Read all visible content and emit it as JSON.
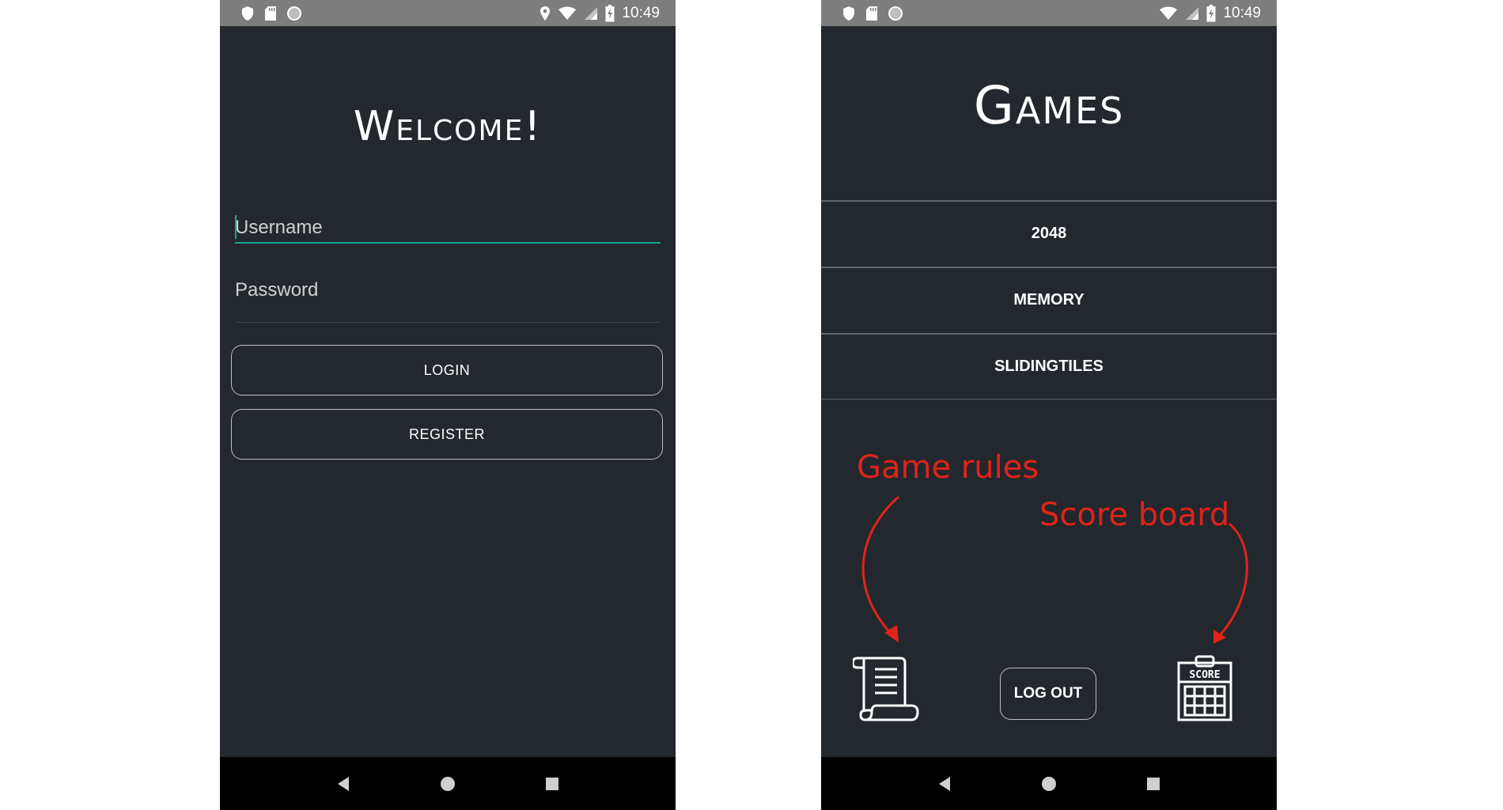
{
  "status_bar": {
    "time": "10:49"
  },
  "login_screen": {
    "title": "Welcome!",
    "username_placeholder": "Username",
    "password_placeholder": "Password",
    "login_label": "LOGIN",
    "register_label": "REGISTER"
  },
  "games_screen": {
    "title": "Games",
    "games": [
      "2048",
      "MEMORY",
      "SLIDINGTILES"
    ],
    "logout_label": "LOG OUT",
    "annotation_rules": "Game rules",
    "annotation_score": "Score board",
    "score_icon_text": "SCORE"
  },
  "colors": {
    "background": "#23282e",
    "status_bar": "#7d7d7d",
    "accent": "#1aa491",
    "annotation": "#e0231a"
  },
  "icons": [
    "shield-icon",
    "sd-card-icon",
    "circle-icon",
    "location-icon",
    "wifi-icon",
    "signal-icon",
    "battery-charging-icon",
    "back-icon",
    "home-icon",
    "recents-icon",
    "scroll-icon",
    "scoreboard-icon"
  ]
}
